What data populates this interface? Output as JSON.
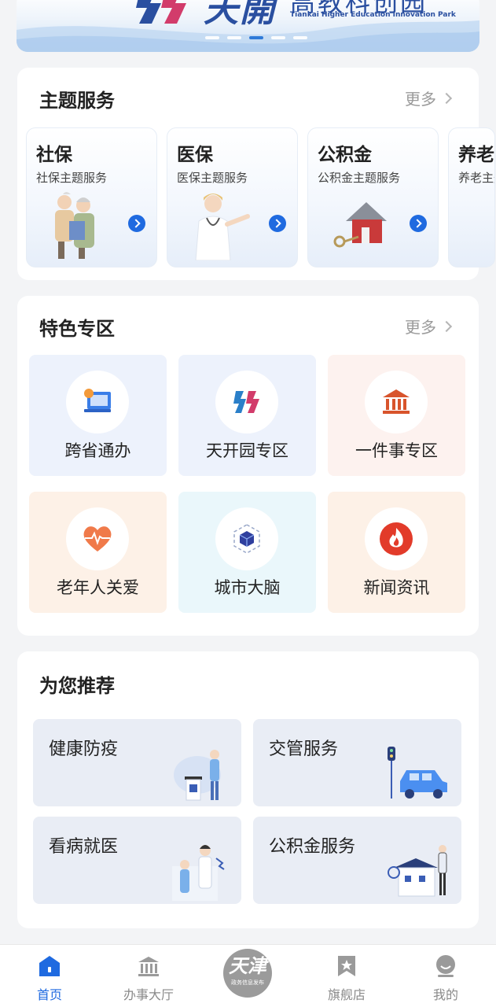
{
  "banner": {
    "logo_text": "天開",
    "cn_title": "高教科创园",
    "en_title": "Tiankai Higher Education Innovation Park",
    "slide_count": 5,
    "active_slide": 3
  },
  "theme_services": {
    "title": "主题服务",
    "more_label": "更多",
    "items": [
      {
        "title": "社保",
        "subtitle": "社保主题服务"
      },
      {
        "title": "医保",
        "subtitle": "医保主题服务"
      },
      {
        "title": "公积金",
        "subtitle": "公积金主题服务"
      },
      {
        "title": "养老",
        "subtitle": "养老主题服务"
      }
    ]
  },
  "feature_zone": {
    "title": "特色专区",
    "more_label": "更多",
    "items": [
      {
        "label": "跨省通办",
        "icon": "computer-icon",
        "bg": "#edf2fc"
      },
      {
        "label": "天开园专区",
        "icon": "tiankai-logo-icon",
        "bg": "#edf2fc"
      },
      {
        "label": "一件事专区",
        "icon": "bank-icon",
        "bg": "#fdf2ef"
      },
      {
        "label": "老年人关爱",
        "icon": "heart-pulse-icon",
        "bg": "#fdf1e7"
      },
      {
        "label": "城市大脑",
        "icon": "cube-icon",
        "bg": "#eaf7fb"
      },
      {
        "label": "新闻资讯",
        "icon": "flame-icon",
        "bg": "#fdf1e7"
      }
    ]
  },
  "recommend": {
    "title": "为您推荐",
    "items": [
      {
        "label": "健康防疫"
      },
      {
        "label": "交管服务"
      },
      {
        "label": "看病就医"
      },
      {
        "label": "公积金服务"
      }
    ]
  },
  "tabbar": {
    "items": [
      {
        "label": "首页",
        "icon": "home-icon",
        "active": true
      },
      {
        "label": "办事大厅",
        "icon": "hall-icon",
        "active": false
      },
      {
        "label": "旗舰店",
        "icon": "bookmark-star-icon",
        "active": false
      },
      {
        "label": "我的",
        "icon": "user-icon",
        "active": false
      }
    ],
    "center_badge": {
      "big": "天津",
      "small": "政务信息发布"
    }
  },
  "colors": {
    "accent": "#1f6ae0",
    "inactive": "#8a8a8a"
  }
}
